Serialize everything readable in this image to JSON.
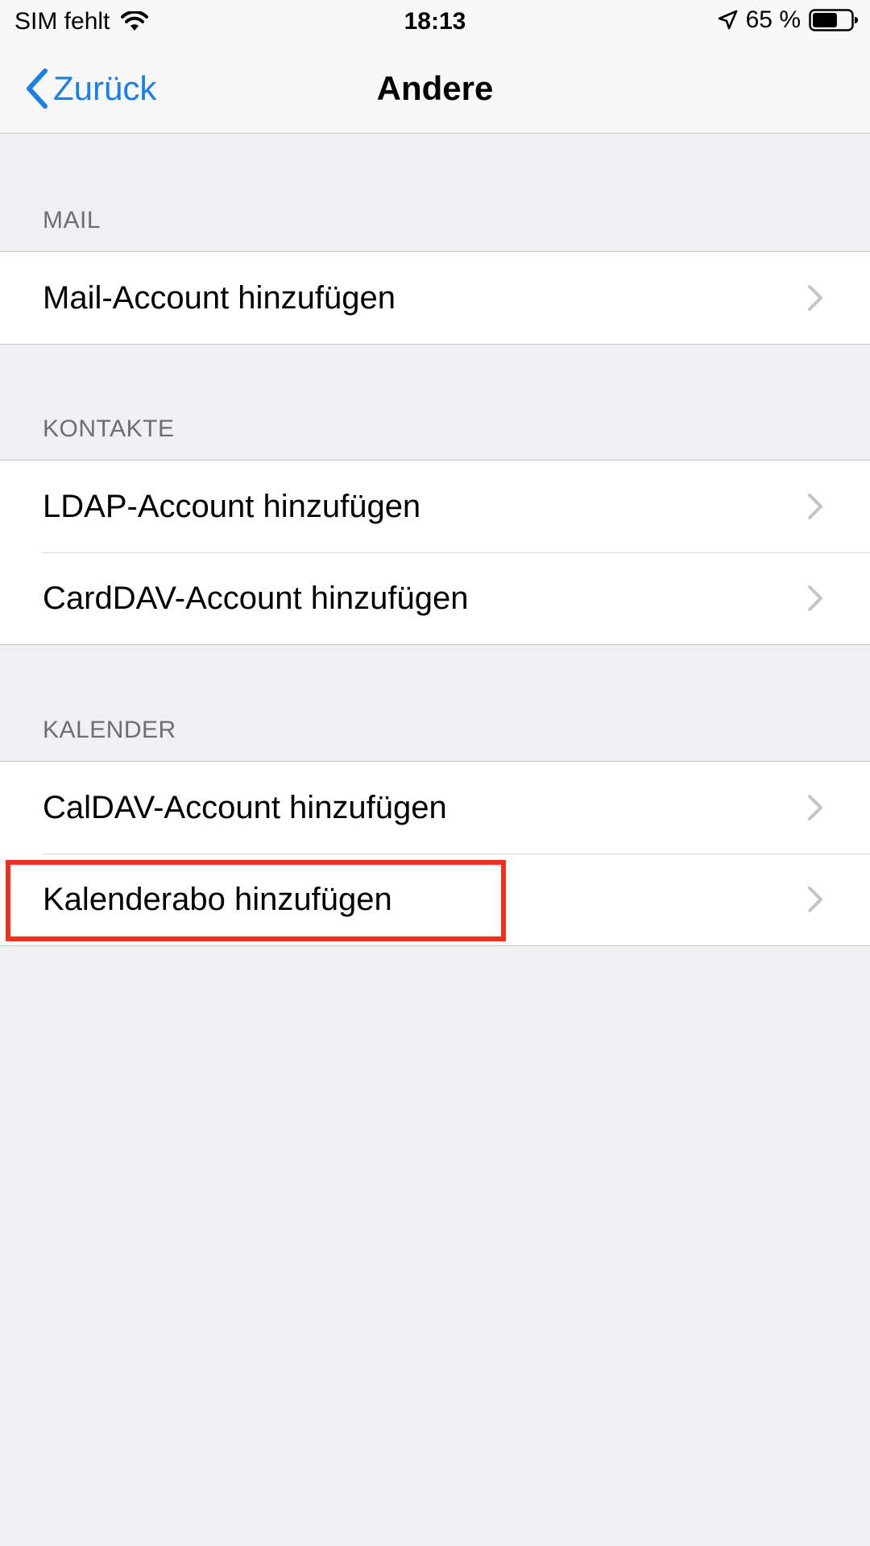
{
  "status_bar": {
    "carrier": "SIM fehlt",
    "time": "18:13",
    "battery_percent": "65 %",
    "battery_level": 0.65,
    "icons": [
      "wifi-icon",
      "location-arrow-icon",
      "battery-icon"
    ]
  },
  "nav": {
    "back_label": "Zurück",
    "title": "Andere"
  },
  "sections": {
    "mail": {
      "header": "MAIL",
      "items": [
        {
          "label": "Mail-Account hinzufügen"
        }
      ]
    },
    "contacts": {
      "header": "KONTAKTE",
      "items": [
        {
          "label": "LDAP-Account hinzufügen"
        },
        {
          "label": "CardDAV-Account hinzufügen"
        }
      ]
    },
    "calendar": {
      "header": "KALENDER",
      "items": [
        {
          "label": "CalDAV-Account hinzufügen"
        },
        {
          "label": "Kalenderabo hinzufügen"
        }
      ]
    }
  },
  "colors": {
    "accent": "#1a7fe8",
    "background": "#efeff4",
    "highlight": "#f0301a",
    "section_header": "#6d6d72",
    "chevron": "#c4c4c9"
  }
}
